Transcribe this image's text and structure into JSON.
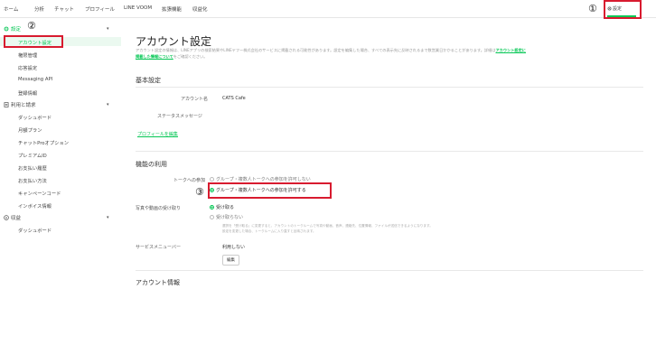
{
  "nav": {
    "items": [
      "ホーム",
      "分析",
      "チャット",
      "プロフィール",
      "LINE VOOM",
      "拡張機能",
      "収益化"
    ],
    "settings_label": "設定",
    "settings_icon": "gear-icon"
  },
  "annotations": [
    "①",
    "②",
    "③"
  ],
  "sidebar": {
    "group_settings": "設定",
    "items_settings": [
      "アカウント設定",
      "権限管理",
      "応答設定",
      "Messaging API",
      "登録情報"
    ],
    "group_billing": "利用と請求",
    "items_billing": [
      "ダッシュボード",
      "月額プラン",
      "チャットProオプション",
      "プレミアムID",
      "お支払い履歴",
      "お支払い方法",
      "キャンペーンコード",
      "インボイス情報"
    ],
    "group_revenue": "収益",
    "items_revenue": [
      "ダッシュボード"
    ]
  },
  "main": {
    "title": "アカウント設定",
    "desc_line1": "アカウント設定の情報は、LINEアプリの検索結果やLINEヤフー株式会社のサービスに掲載される可能性があります。設定を編集した場合、すべての表示先に反映されるまで数営業日かかることがあります。詳細は",
    "desc_link1": "アカウント設定に",
    "desc_link2": "掲載した情報について",
    "desc_line2": "をご確認ください。",
    "basic": {
      "heading": "基本設定",
      "account_name_label": "アカウント名",
      "account_name_value": "CATS Cafe",
      "status_label": "ステータスメッセージ",
      "profile_link": "プロフィールを編集"
    },
    "features": {
      "heading": "機能の利用",
      "talk_label": "トークへの参加",
      "talk_options": [
        "グループ・複数人トークへの参加を許可しない",
        "グループ・複数人トークへの参加を許可する"
      ],
      "media_label": "写真や動画の受け取り",
      "media_options": [
        "受け取る",
        "受け取らない"
      ],
      "media_note1": "選択を「受け取る」に変更すると、アカウントのトークルームで写真や動画、音声、連絡先、位置情報、ファイルが送信できるようになります。",
      "media_note2": "設定を変更した場合、トークルームに入り直すと反映されます。",
      "service_menu_label": "サービスメニューバー",
      "service_menu_value": "利用しない",
      "edit_button": "編集"
    },
    "account_info_heading": "アカウント情報"
  },
  "colors": {
    "accent": "#06c755",
    "highlight": "#d81b2f"
  }
}
